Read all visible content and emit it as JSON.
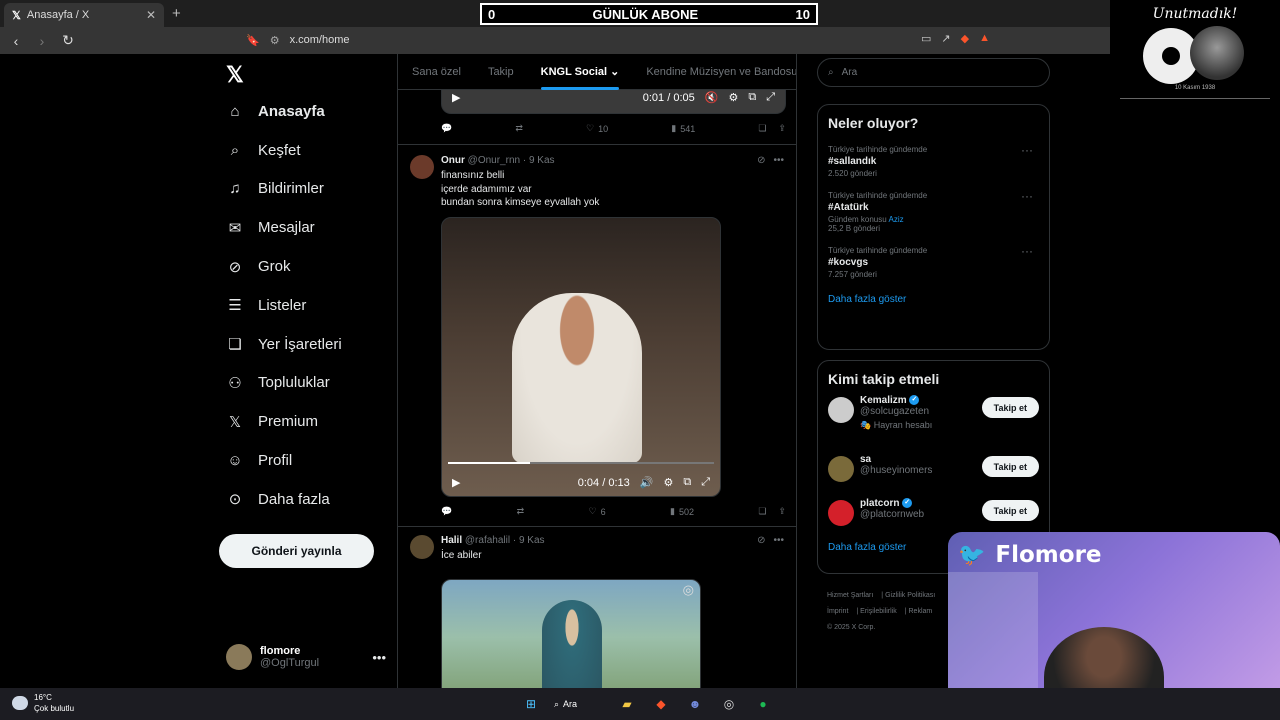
{
  "browser": {
    "tab_title": "Anasayfa / X",
    "url": "x.com/home",
    "brave_badge": "1"
  },
  "overlay": {
    "counter_left": "0",
    "counter_title": "GÜNLÜK ABONE",
    "counter_right": "10",
    "logo_text": "Unutmadık!",
    "logo_date": "10 Kasım 1938"
  },
  "sidebar": {
    "items": [
      {
        "label": "Anasayfa",
        "icon": "home-icon"
      },
      {
        "label": "Keşfet",
        "icon": "search-icon"
      },
      {
        "label": "Bildirimler",
        "icon": "bell-icon"
      },
      {
        "label": "Mesajlar",
        "icon": "mail-icon"
      },
      {
        "label": "Grok",
        "icon": "grok-icon"
      },
      {
        "label": "Listeler",
        "icon": "list-icon"
      },
      {
        "label": "Yer İşaretleri",
        "icon": "bookmark-icon"
      },
      {
        "label": "Topluluklar",
        "icon": "communities-icon"
      },
      {
        "label": "Premium",
        "icon": "x-icon"
      },
      {
        "label": "Profil",
        "icon": "person-icon"
      },
      {
        "label": "Daha fazla",
        "icon": "more-icon"
      }
    ],
    "post_button": "Gönderi yayınla",
    "account_name": "flomore",
    "account_handle": "@OglTurgul"
  },
  "feed": {
    "tabs": [
      "Sana özel",
      "Takip",
      "KNGL Social",
      "Kendine Müzisyen ve Bandosu"
    ],
    "active_tab": "KNGL Social",
    "top_video": {
      "time": "0:01 / 0:05"
    },
    "top_actions": {
      "likes": "10",
      "views": "541"
    },
    "posts": [
      {
        "name": "Onur",
        "handle": "@Onur_rnn",
        "date": "9 Kas",
        "lines": [
          "finansınız belli",
          "içerde adamımız var",
          "bundan sonra kimseye eyvallah yok"
        ],
        "video_time": "0:04 / 0:13",
        "progress": 0.31,
        "likes": "6",
        "views": "502"
      },
      {
        "name": "Halil",
        "handle": "@rafahalil",
        "date": "9 Kas",
        "lines": [
          "İce abiler"
        ]
      }
    ]
  },
  "right": {
    "search_placeholder": "Ara",
    "trends_title": "Neler oluyor?",
    "trends": [
      {
        "context": "Türkiye tarihinde gündemde",
        "tag": "#sallandık",
        "count": "2.520 gönderi"
      },
      {
        "context": "Türkiye tarihinde gündemde",
        "tag": "#Atatürk",
        "extra": "Gündem konusu",
        "extra_link": "Aziz",
        "count": "25,2 B gönderi"
      },
      {
        "context": "Türkiye tarihinde gündemde",
        "tag": "#kocvgs",
        "count": "7.257 gönderi"
      }
    ],
    "show_more": "Daha fazla göster",
    "follow_title": "Kimi takip etmeli",
    "follow": [
      {
        "name": "Kemalizm",
        "handle": "@solcugazeten",
        "sub": "Hayran hesabı",
        "verified": true,
        "button": "Takip et"
      },
      {
        "name": "sa",
        "handle": "@huseyinomers",
        "verified": false,
        "button": "Takip et"
      },
      {
        "name": "platcorn",
        "handle": "@platcornweb",
        "verified": true,
        "button": "Takip et"
      }
    ],
    "footer": [
      "Hizmet Şartları",
      "Gizlilik Politikası",
      "İmprint",
      "Erişilebilirlik",
      "Reklam",
      "© 2025 X Corp."
    ]
  },
  "webcam": {
    "title": "Flomore"
  },
  "taskbar": {
    "temp": "16°C",
    "weather": "Çok bulutlu",
    "search_label": "Ara"
  }
}
